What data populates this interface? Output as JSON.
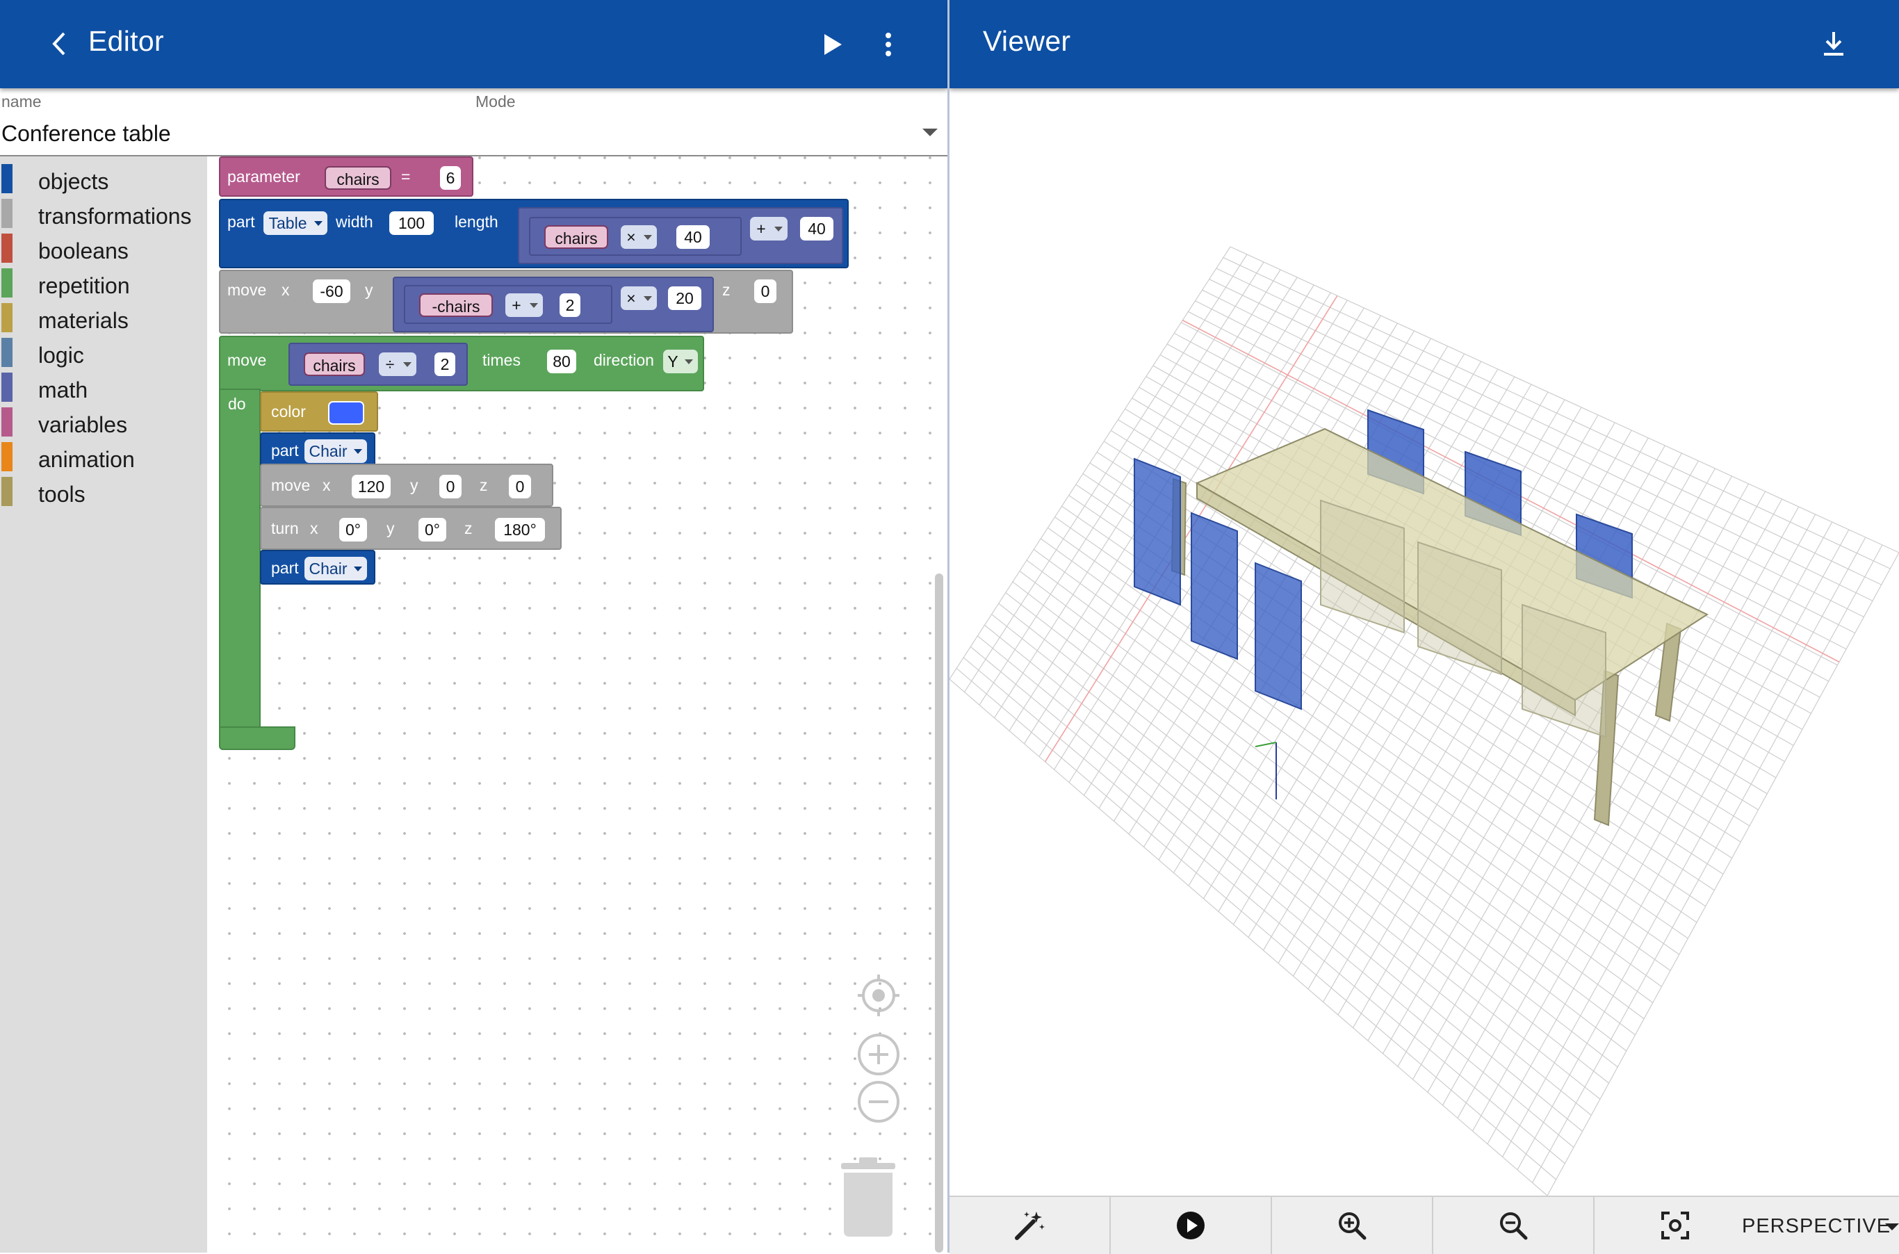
{
  "editor": {
    "title": "Editor",
    "back_icon": "chevron-left-icon",
    "run_icon": "play-icon",
    "menu_icon": "more-vert-icon",
    "name_label": "name",
    "mode_label": "Mode",
    "name_value": "Conference table"
  },
  "viewer": {
    "title": "Viewer",
    "download_icon": "download-icon",
    "toolbar": {
      "magic_icon": "magic-wand-icon",
      "play_icon": "play-circle-icon",
      "zoom_in_icon": "zoom-in-icon",
      "zoom_out_icon": "zoom-out-icon",
      "focus_icon": "center-focus-icon",
      "projection": "PERSPECTIVE"
    }
  },
  "toolbox": {
    "categories": [
      {
        "label": "objects",
        "color": "#1350a3"
      },
      {
        "label": "transformations",
        "color": "#a8a8a8"
      },
      {
        "label": "booleans",
        "color": "#c0503e"
      },
      {
        "label": "repetition",
        "color": "#5ba55b"
      },
      {
        "label": "materials",
        "color": "#bba045"
      },
      {
        "label": "logic",
        "color": "#5b80a5"
      },
      {
        "label": "math",
        "color": "#5a64a8"
      },
      {
        "label": "variables",
        "color": "#b65a8c"
      },
      {
        "label": "animation",
        "color": "#e8861a"
      },
      {
        "label": "tools",
        "color": "#a89a5b"
      }
    ]
  },
  "blocks": {
    "param": {
      "kw": "parameter",
      "var": "chairs",
      "eq": "=",
      "val": "6"
    },
    "table": {
      "kw": "part",
      "obj": "Table",
      "width_kw": "width",
      "width": "100",
      "length_kw": "length",
      "var": "chairs",
      "op1": "×",
      "n1": "40",
      "op2": "+",
      "n2": "40"
    },
    "move1": {
      "kw": "move",
      "x_kw": "x",
      "x": "-60",
      "y_kw": "y",
      "var": "-chairs",
      "op1": "+",
      "n1": "2",
      "op2": "×",
      "n2": "20",
      "z_kw": "z",
      "z": "0"
    },
    "repeat": {
      "kw": "move",
      "var": "chairs",
      "op": "÷",
      "n": "2",
      "times_kw": "times",
      "times": "80",
      "dir_kw": "direction",
      "dir": "Y",
      "do_kw": "do"
    },
    "color": {
      "kw": "color"
    },
    "chair1": {
      "kw": "part",
      "obj": "Chair"
    },
    "move2": {
      "kw": "move",
      "x_kw": "x",
      "x": "120",
      "y_kw": "y",
      "y": "0",
      "z_kw": "z",
      "z": "0"
    },
    "turn": {
      "kw": "turn",
      "x_kw": "x",
      "x": "0°",
      "y_kw": "y",
      "y": "0°",
      "z_kw": "z",
      "z": "180°"
    },
    "chair2": {
      "kw": "part",
      "obj": "Chair"
    }
  },
  "workspace_controls": {
    "recenter_icon": "recenter-icon",
    "zoom_in_icon": "zoom-in-circle-icon",
    "zoom_out_icon": "zoom-out-circle-icon",
    "trash_icon": "trash-icon"
  }
}
